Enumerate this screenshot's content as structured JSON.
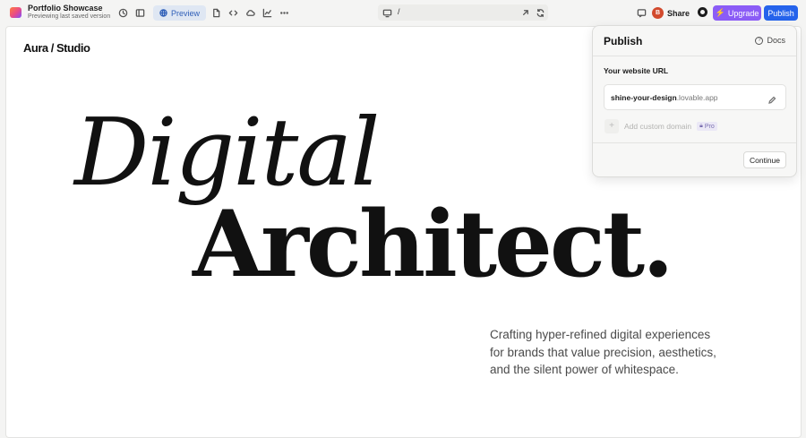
{
  "app": {
    "project_name": "Portfolio Showcase",
    "project_subtitle": "Previewing last saved version"
  },
  "toolbar": {
    "preview_label": "Preview",
    "url_path": "/",
    "share_label": "Share",
    "avatar_initial": "B",
    "upgrade_label": "Upgrade",
    "publish_label": "Publish",
    "icons": [
      "history-icon",
      "sidebar-icon",
      "file-icon",
      "code-icon",
      "cloud-icon",
      "chart-icon",
      "more-icon",
      "desktop-icon",
      "external-link-icon",
      "refresh-icon",
      "chat-icon",
      "github-icon",
      "bolt-icon"
    ]
  },
  "site": {
    "brand": "Aura / Studio",
    "hero_line1": "Digital",
    "hero_line2": "Architect.",
    "tagline": "Crafting hyper-refined digital experiences for brands that value precision, aesthetics, and the silent power of whitespace."
  },
  "publish_panel": {
    "title": "Publish",
    "docs_label": "Docs",
    "url_label": "Your website URL",
    "url_slug": "shine-your-design",
    "url_suffix": ".lovable.app",
    "custom_domain_label": "Add custom domain",
    "pro_badge": "Pro",
    "continue_label": "Continue"
  },
  "colors": {
    "upgrade": "#8b5cf6",
    "publish": "#2563eb",
    "preview_bg": "#dfe7f3",
    "avatar": "#d24a2d"
  }
}
